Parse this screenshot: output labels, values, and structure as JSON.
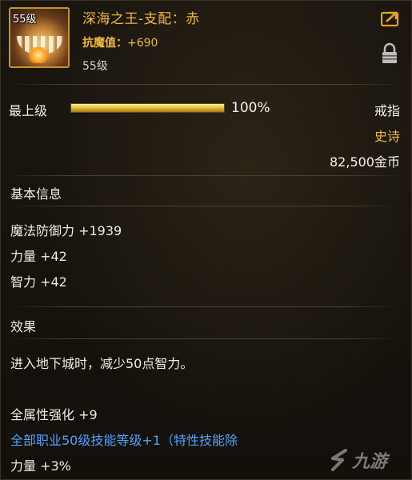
{
  "item": {
    "level_badge": "55级",
    "name": "深海之王-支配：赤",
    "anti_magic_label": "抗魔值：",
    "anti_magic_value": "+690",
    "level_text": "55级",
    "icon": "fang-necklace-item-icon"
  },
  "grade": {
    "label": "最上级",
    "percent_text": "100%",
    "fill_fraction": 1.0
  },
  "meta": {
    "type": "戒指",
    "rarity": "史诗",
    "price": "82,500金币"
  },
  "basic_info": {
    "title": "基本信息",
    "stats": [
      "魔法防御力 +1939",
      "力量 +42",
      "智力 +42"
    ]
  },
  "effect": {
    "title": "效果",
    "text": "进入地下城时，减少50点智力。",
    "lines": [
      "全属性强化 +9",
      "全部职业50级技能等级+1（特性技能除",
      "力量 +3%"
    ]
  },
  "watermark": {
    "text": "九游"
  },
  "colors": {
    "gold": "#f2b83a",
    "blue_link": "#4fa2ff",
    "text": "#f0ece3"
  }
}
